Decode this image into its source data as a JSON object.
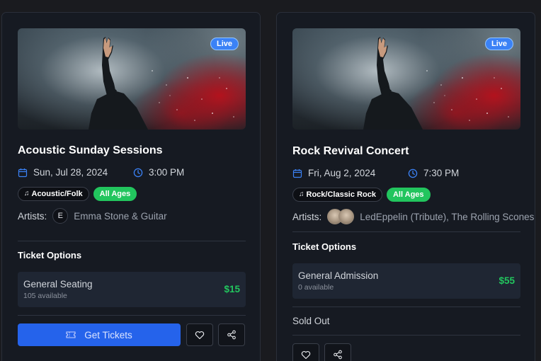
{
  "events": [
    {
      "badge": "Live",
      "title": "Acoustic Sunday Sessions",
      "date": "Sun, Jul 28, 2024",
      "time": "3:00 PM",
      "genre": "Acoustic/Folk",
      "age": "All Ages",
      "artists_label": "Artists:",
      "artist_initial": "E",
      "artist_names": "Emma Stone & Guitar",
      "ticket_options_label": "Ticket Options",
      "ticket": {
        "name": "General Seating",
        "availability": "105 available",
        "price": "$15"
      },
      "cta_label": "Get Tickets"
    },
    {
      "badge": "Live",
      "title": "Rock Revival Concert",
      "date": "Fri, Aug 2, 2024",
      "time": "7:30 PM",
      "genre": "Rock/Classic Rock",
      "age": "All Ages",
      "artists_label": "Artists:",
      "artist_names": "LedEppelin (Tribute), The Rolling Scones",
      "ticket_options_label": "Ticket Options",
      "ticket": {
        "name": "General Admission",
        "availability": "0 available",
        "price": "$55"
      },
      "status_label": "Sold Out"
    }
  ],
  "colors": {
    "accent": "#2563eb",
    "badge": "#3b82f6",
    "success": "#22c55e",
    "card_bg": "#161a22",
    "page_bg": "#1a1b1f"
  },
  "icons": [
    "calendar-icon",
    "clock-icon",
    "music-note-icon",
    "ticket-icon",
    "heart-icon",
    "share-icon"
  ]
}
